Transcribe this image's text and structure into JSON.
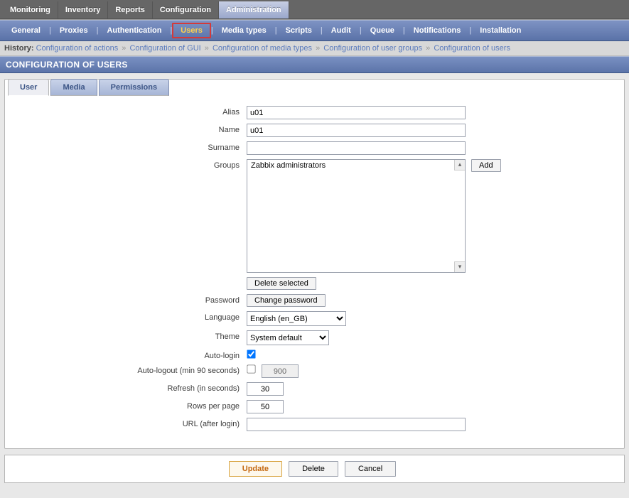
{
  "main_nav": {
    "monitoring": "Monitoring",
    "inventory": "Inventory",
    "reports": "Reports",
    "configuration": "Configuration",
    "administration": "Administration"
  },
  "sub_nav": {
    "general": "General",
    "proxies": "Proxies",
    "authentication": "Authentication",
    "users": "Users",
    "media_types": "Media types",
    "scripts": "Scripts",
    "audit": "Audit",
    "queue": "Queue",
    "notifications": "Notifications",
    "installation": "Installation"
  },
  "history": {
    "label": "History:",
    "items": [
      "Configuration of actions",
      "Configuration of GUI",
      "Configuration of media types",
      "Configuration of user groups",
      "Configuration of users"
    ]
  },
  "page_title": "CONFIGURATION OF USERS",
  "tabs": {
    "user": "User",
    "media": "Media",
    "permissions": "Permissions"
  },
  "form": {
    "alias_label": "Alias",
    "alias_value": "u01",
    "name_label": "Name",
    "name_value": "u01",
    "surname_label": "Surname",
    "surname_value": "",
    "groups_label": "Groups",
    "groups_item": "Zabbix administrators",
    "add_btn": "Add",
    "delete_selected_btn": "Delete selected",
    "password_label": "Password",
    "change_password_btn": "Change password",
    "language_label": "Language",
    "language_value": "English (en_GB)",
    "theme_label": "Theme",
    "theme_value": "System default",
    "autologin_label": "Auto-login",
    "autologout_label": "Auto-logout (min 90 seconds)",
    "autologout_value": "900",
    "refresh_label": "Refresh (in seconds)",
    "refresh_value": "30",
    "rows_label": "Rows per page",
    "rows_value": "50",
    "url_label": "URL (after login)",
    "url_value": ""
  },
  "actions": {
    "update": "Update",
    "delete": "Delete",
    "cancel": "Cancel"
  }
}
